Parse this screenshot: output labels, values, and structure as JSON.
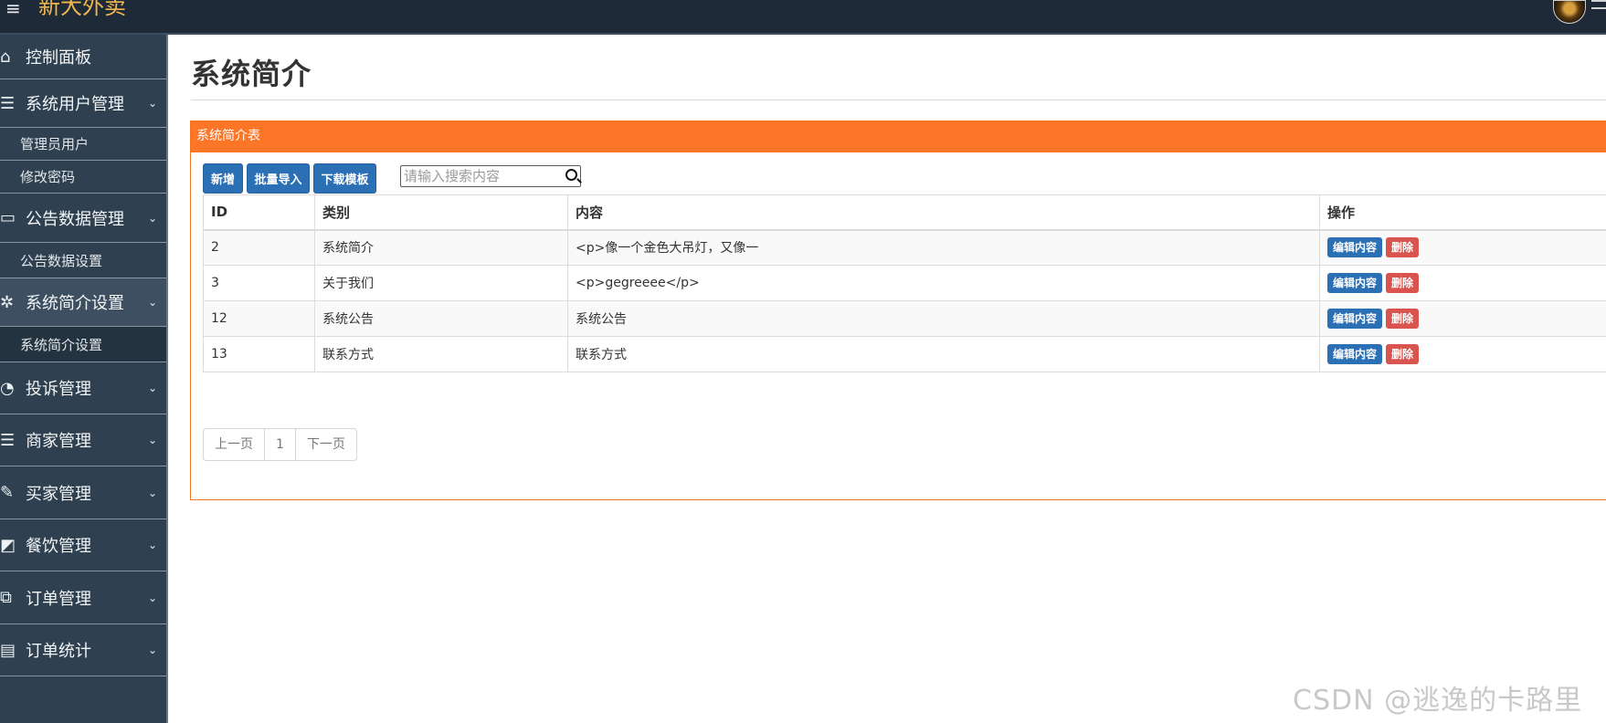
{
  "app": {
    "title": "新大外卖",
    "menu_icon": "hamburger-icon"
  },
  "sidebar": {
    "items": [
      {
        "label": "控制面板",
        "icon": "home-icon"
      },
      {
        "label": "系统用户管理",
        "icon": "list-icon"
      },
      {
        "label": "管理员用户"
      },
      {
        "label": "修改密码"
      },
      {
        "label": "公告数据管理",
        "icon": "monitor-icon"
      },
      {
        "label": "公告数据设置"
      },
      {
        "label": "系统简介设置",
        "icon": "atom-icon"
      },
      {
        "label": "系统简介设置"
      },
      {
        "label": "投诉管理",
        "icon": "pie-icon"
      },
      {
        "label": "商家管理",
        "icon": "list-icon"
      },
      {
        "label": "买家管理",
        "icon": "pencil-icon"
      },
      {
        "label": "餐饮管理",
        "icon": "edit-box-icon"
      },
      {
        "label": "订单管理",
        "icon": "share-icon"
      },
      {
        "label": "订单统计",
        "icon": "calendar-icon"
      }
    ],
    "chevron": "⌄"
  },
  "main": {
    "page_title": "系统简介",
    "panel_title": "系统简介表",
    "toolbar": {
      "add": "新增",
      "import": "批量导入",
      "download": "下载模板",
      "search_placeholder": "请输入搜索内容"
    },
    "table": {
      "headers": [
        "ID",
        "类别",
        "内容",
        "操作"
      ],
      "rows": [
        {
          "id": "2",
          "category": "系统简介",
          "content": "<p>像一个金色大吊灯，又像一"
        },
        {
          "id": "3",
          "category": "关于我们",
          "content": "<p>gegreeee</p>"
        },
        {
          "id": "12",
          "category": "系统公告",
          "content": "系统公告"
        },
        {
          "id": "13",
          "category": "联系方式",
          "content": "联系方式"
        }
      ],
      "edit_label": "编辑内容",
      "delete_label": "删除"
    },
    "pager": {
      "prev": "上一页",
      "page": "1",
      "next": "下一页"
    }
  },
  "watermark": "CSDN @逃逸的卡路里",
  "colors": {
    "topbar": "#1f2a38",
    "sidebar": "#2f4050",
    "panel_head": "#fd7628",
    "primary": "#2b6fb5",
    "danger": "#d9534f"
  }
}
